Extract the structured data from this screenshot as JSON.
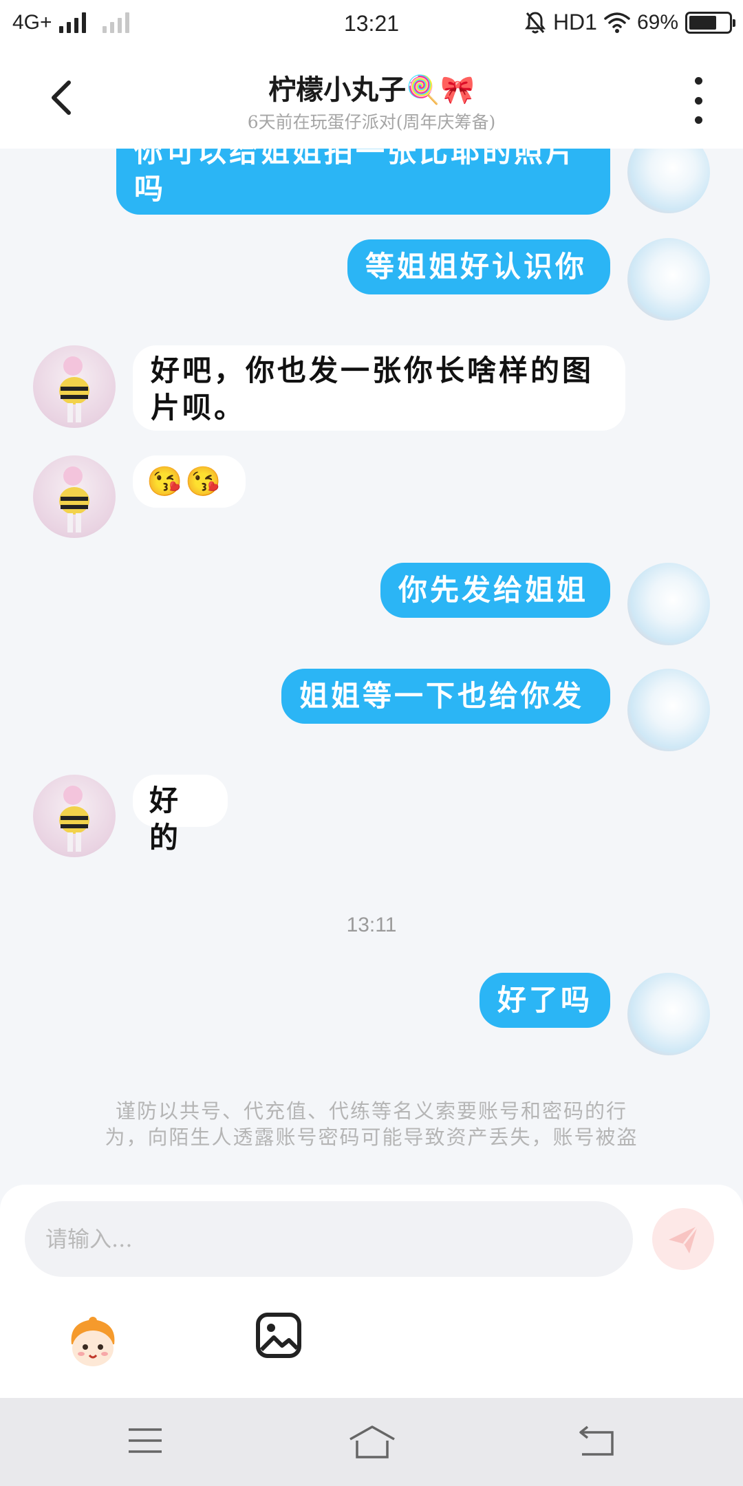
{
  "status_bar": {
    "network": "4G+",
    "time": "13:21",
    "hd": "HD1",
    "battery_text": "69%",
    "battery_level": 0.69
  },
  "header": {
    "title": "柠檬小丸子🍭🎀",
    "subtitle": "6天前在玩蛋仔派对(周年庆筹备)"
  },
  "messages": [
    {
      "side": "out",
      "lines": [
        "你可以给姐姐拍一张比耶的照片",
        "吗"
      ]
    },
    {
      "side": "out",
      "lines": [
        "等姐姐好认识你"
      ]
    },
    {
      "side": "in",
      "lines": [
        "好吧，你也发一张你长啥样的图",
        "片呗。"
      ]
    },
    {
      "side": "in",
      "lines": [
        "😘😘"
      ]
    },
    {
      "side": "out",
      "lines": [
        "你先发给姐姐"
      ]
    },
    {
      "side": "out",
      "lines": [
        "姐姐等一下也给你发"
      ]
    },
    {
      "side": "in",
      "lines": [
        "好的"
      ]
    },
    {
      "side": "out",
      "lines": [
        "好了吗"
      ]
    }
  ],
  "chat_timestamp": "13:11",
  "warning": {
    "line1": "谨防以共号、代充值、代练等名义索要账号和密码的行",
    "line2": "为，向陌生人透露账号密码可能导致资产丢失，账号被盗"
  },
  "input": {
    "placeholder": "请输入..."
  },
  "colors": {
    "outgoing_bubble": "#2bb5f5",
    "incoming_bubble": "#ffffff",
    "background": "#f4f6f9",
    "send_button": "#fde8e7"
  },
  "icons": {
    "back": "back-arrow-icon",
    "more": "more-vertical-icon",
    "send": "send-icon",
    "emoji": "emoji-mascot-icon",
    "image": "image-icon",
    "nav_menu": "menu-icon",
    "nav_home": "home-icon",
    "nav_back": "back-icon"
  }
}
